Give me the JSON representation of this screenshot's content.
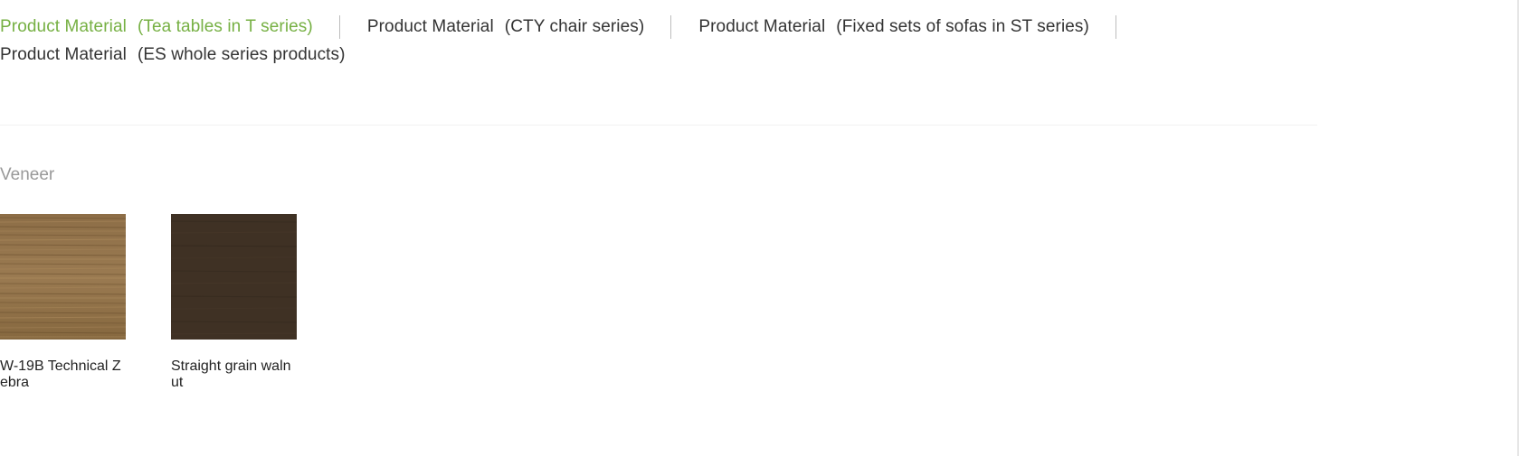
{
  "tabs": [
    {
      "prefix": "Product Material",
      "detail": "(Tea tables in T series)",
      "active": true
    },
    {
      "prefix": "Product Material",
      "detail": "(CTY chair series)",
      "active": false
    },
    {
      "prefix": "Product Material",
      "detail": "(Fixed sets of sofas in ST series)",
      "active": false
    },
    {
      "prefix": "Product Material",
      "detail": "(ES whole series products)",
      "active": false
    }
  ],
  "section": {
    "title": "Veneer"
  },
  "swatches": [
    {
      "label": "W-19B Technical Zebra",
      "material": "light-zebra-wood",
      "color": "#8a6b44"
    },
    {
      "label": "Straight grain walnut",
      "material": "dark-walnut-wood",
      "color": "#3e3023"
    }
  ],
  "colors": {
    "accent": "#76b043",
    "text": "#333333",
    "muted": "#999999"
  }
}
